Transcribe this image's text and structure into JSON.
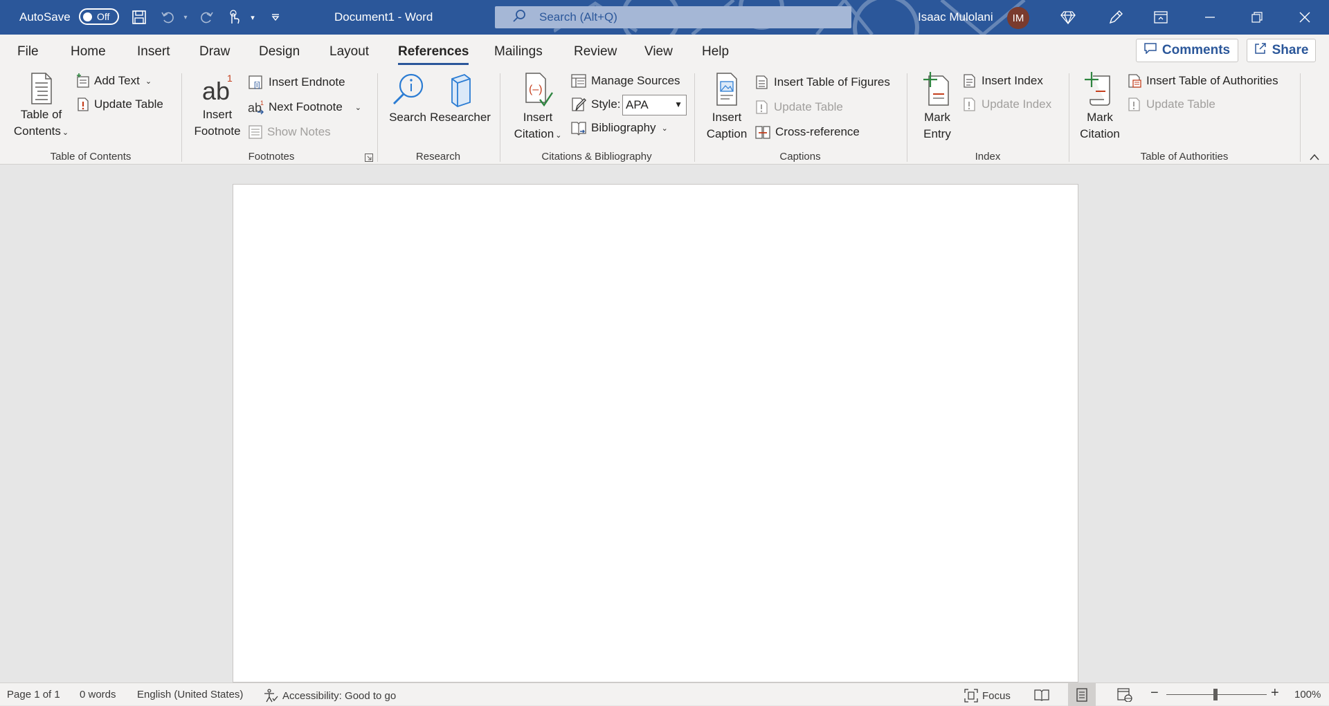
{
  "titlebar": {
    "autosave_label": "AutoSave",
    "autosave_state": "Off",
    "doc_title": "Document1  -  Word",
    "search_placeholder": "Search (Alt+Q)",
    "user_name": "Isaac Mulolani",
    "user_initials": "IM"
  },
  "tabs": [
    "File",
    "Home",
    "Insert",
    "Draw",
    "Design",
    "Layout",
    "References",
    "Mailings",
    "Review",
    "View",
    "Help"
  ],
  "active_tab": "References",
  "actions": {
    "comments": "Comments",
    "share": "Share"
  },
  "ribbon": {
    "toc": {
      "label": "Table of Contents",
      "table_of_contents_l1": "Table of",
      "table_of_contents_l2": "Contents",
      "add_text": "Add Text",
      "update_table": "Update Table"
    },
    "footnotes": {
      "label": "Footnotes",
      "insert_footnote_l1": "Insert",
      "insert_footnote_l2": "Footnote",
      "insert_endnote": "Insert Endnote",
      "next_footnote": "Next Footnote",
      "show_notes": "Show Notes"
    },
    "research": {
      "label": "Research",
      "search": "Search",
      "researcher": "Researcher"
    },
    "citations": {
      "label": "Citations & Bibliography",
      "insert_citation_l1": "Insert",
      "insert_citation_l2": "Citation",
      "manage_sources": "Manage Sources",
      "style_label": "Style:",
      "style_value": "APA",
      "bibliography": "Bibliography"
    },
    "captions": {
      "label": "Captions",
      "insert_caption_l1": "Insert",
      "insert_caption_l2": "Caption",
      "insert_table_of_figures": "Insert Table of Figures",
      "update_table": "Update Table",
      "cross_reference": "Cross-reference"
    },
    "index": {
      "label": "Index",
      "mark_entry_l1": "Mark",
      "mark_entry_l2": "Entry",
      "insert_index": "Insert Index",
      "update_index": "Update Index"
    },
    "authorities": {
      "label": "Table of Authorities",
      "mark_citation_l1": "Mark",
      "mark_citation_l2": "Citation",
      "insert_table_of_authorities": "Insert Table of Authorities",
      "update_table": "Update Table"
    }
  },
  "statusbar": {
    "page": "Page 1 of 1",
    "words": "0 words",
    "language": "English (United States)",
    "accessibility": "Accessibility: Good to go",
    "focus": "Focus",
    "zoom": "100%"
  },
  "colors": {
    "brand": "#2b579a",
    "ribbon_bg": "#f3f2f1",
    "canvas_bg": "#e6e6e6"
  }
}
